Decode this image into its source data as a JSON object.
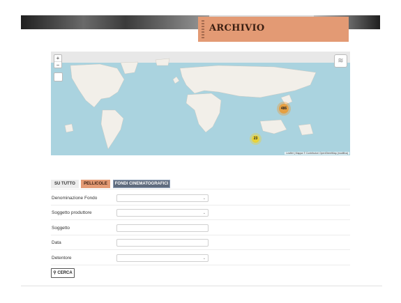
{
  "header": {
    "title": "ARCHIVIO"
  },
  "map": {
    "zoom_in": "+",
    "zoom_out": "−",
    "layers_icon": "layers-icon",
    "clusters": [
      {
        "count": "486"
      },
      {
        "count": "23"
      }
    ],
    "attribution": "Leaflet | Mappa © Contributori OpenStreetMap (modifica)"
  },
  "tabs": [
    {
      "label": "SU TUTTO"
    },
    {
      "label": "PELLICOLE"
    },
    {
      "label": "FONDI CINEMATOGRAFICI"
    }
  ],
  "form": {
    "fields": [
      {
        "label": "Denominazione Fondo",
        "type": "select"
      },
      {
        "label": "Soggetto produttore",
        "type": "select"
      },
      {
        "label": "Soggetto",
        "type": "text"
      },
      {
        "label": "Data",
        "type": "text"
      },
      {
        "label": "Detentore",
        "type": "select"
      }
    ],
    "search_label": "CERCA"
  },
  "colors": {
    "accent": "#e39a74",
    "active_tab": "#5f6b7d",
    "sea": "#aad3df",
    "land": "#f2efe9"
  }
}
